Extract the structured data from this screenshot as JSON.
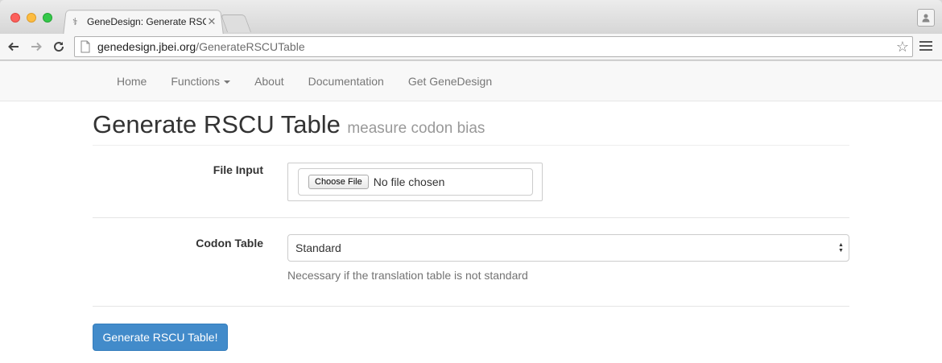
{
  "browser": {
    "tab_title": "GeneDesign: Generate RSC",
    "tab_close": "✕",
    "url_domain": "genedesign.jbei.org",
    "url_path": "/GenerateRSCUTable",
    "star": "☆",
    "favicon": "⚕"
  },
  "navbar": {
    "items": [
      {
        "label": "Home"
      },
      {
        "label": "Functions"
      },
      {
        "label": "About"
      },
      {
        "label": "Documentation"
      },
      {
        "label": "Get GeneDesign"
      }
    ]
  },
  "header": {
    "title": "Generate RSCU Table",
    "subtitle": "measure codon bias"
  },
  "form": {
    "file_input": {
      "label": "File Input",
      "button_label": "Choose File",
      "status": "No file chosen"
    },
    "codon_table": {
      "label": "Codon Table",
      "selected": "Standard",
      "help": "Necessary if the translation table is not standard"
    },
    "submit_label": "Generate RSCU Table!"
  },
  "colors": {
    "primary": "#428bca",
    "navbar_bg": "#f8f8f8"
  }
}
